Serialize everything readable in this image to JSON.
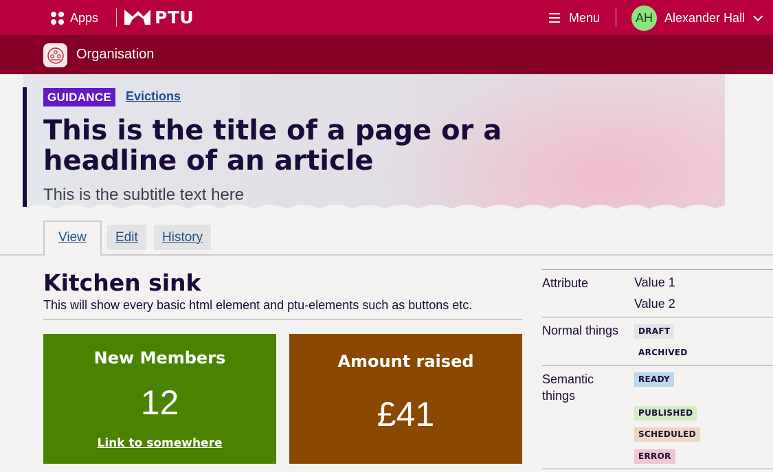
{
  "topbar": {
    "apps_label": "Apps",
    "logo_text": "PTU",
    "menu_label": "Menu",
    "user_initials": "AH",
    "user_name": "Alexander Hall"
  },
  "orgbar": {
    "title": "Organisation"
  },
  "hero": {
    "tag": "GUIDANCE",
    "breadcrumb": "Evictions",
    "title": "This is the title of a page or a headline of an article",
    "subtitle": "This is the subtitle text here"
  },
  "tabs": [
    {
      "label": "View",
      "active": true
    },
    {
      "label": "Edit",
      "active": false
    },
    {
      "label": "History",
      "active": false
    }
  ],
  "main": {
    "heading": "Kitchen sink",
    "description": "This will show every basic html element and ptu-elements such as buttons etc."
  },
  "cards": [
    {
      "title": "New Members",
      "value": "12",
      "link": "Link to somewhere",
      "color": "#4a8300"
    },
    {
      "title": "Amount raised",
      "value": "£41",
      "color": "#8a4800"
    }
  ],
  "attributes": [
    {
      "label": "Attribute",
      "values": [
        "Value 1",
        "Value 2"
      ]
    },
    {
      "label": "Normal things",
      "badges": [
        {
          "text": "DRAFT",
          "color": "#e3e3e3"
        },
        {
          "text": "ARCHIVED",
          "color": "transparent"
        }
      ]
    },
    {
      "label": "Semantic things",
      "badges": [
        {
          "text": "READY",
          "color": "#bcd7ec"
        },
        {
          "text": "PUBLISHED",
          "color": "#d4ebc4"
        },
        {
          "text": "SCHEDULED",
          "color": "#ecd7c2"
        },
        {
          "text": "ERROR",
          "color": "#f0c6d2"
        }
      ]
    }
  ],
  "colors": {
    "brand": "#b8003c",
    "brand_dark": "#840024",
    "guidance_tag": "#6419c9",
    "link": "#1d4f8a"
  }
}
